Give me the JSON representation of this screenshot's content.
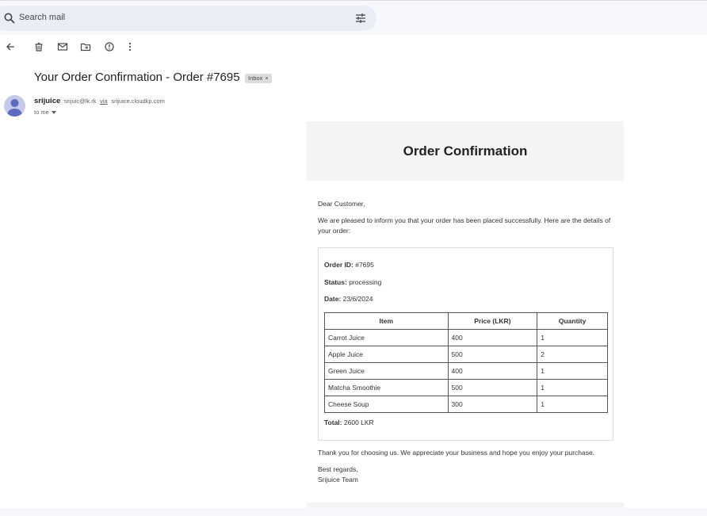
{
  "search": {
    "placeholder": "Search mail"
  },
  "email": {
    "subject": "Your Order Confirmation - Order #7695",
    "label_chip": "Inbox",
    "label_chip_close": "×",
    "sender_name": "srijuice",
    "sender_email": "srijuic@lk.rk",
    "via_label": "via",
    "via_domain": "srijuice.cloudkp.com",
    "to_label": "to me"
  },
  "content": {
    "heading": "Order Confirmation",
    "greeting": "Dear Customer,",
    "intro": "We are pleased to inform you that your order has been placed successfully. Here are the details of your order:",
    "order_id_label": "Order ID:",
    "order_id": "#7695",
    "status_label": "Status:",
    "status": "processing",
    "date_label": "Date:",
    "date": "23/6/2024",
    "table": {
      "headers": [
        "Item",
        "Price (LKR)",
        "Quantity"
      ],
      "rows": [
        [
          "Carrot Juice",
          "400",
          "1"
        ],
        [
          "Apple Juice",
          "500",
          "2"
        ],
        [
          "Green Juice",
          "400",
          "1"
        ],
        [
          "Matcha Smoothie",
          "500",
          "1"
        ],
        [
          "Cheese Soup",
          "300",
          "1"
        ]
      ]
    },
    "total_label": "Total:",
    "total": "2600 LKR",
    "thanks": "Thank you for choosing us. We appreciate your business and hope you enjoy your purchase.",
    "regards": "Best regards,",
    "signature": "Srijuice Team"
  },
  "icons": {
    "search": "search-icon",
    "tune": "tune-icon",
    "back": "back-arrow-icon",
    "delete": "trash-icon",
    "mark_unread": "mark-unread-icon",
    "move": "move-to-folder-icon",
    "report": "report-spam-icon",
    "more": "more-vert-icon"
  },
  "colors": {
    "app_bg": "#f6f8fc",
    "search_bg": "#e9eef6",
    "avatar_bg": "#c5cae9",
    "avatar_fg": "#5c6bc0",
    "email_header_bg": "#f4f4f4"
  }
}
